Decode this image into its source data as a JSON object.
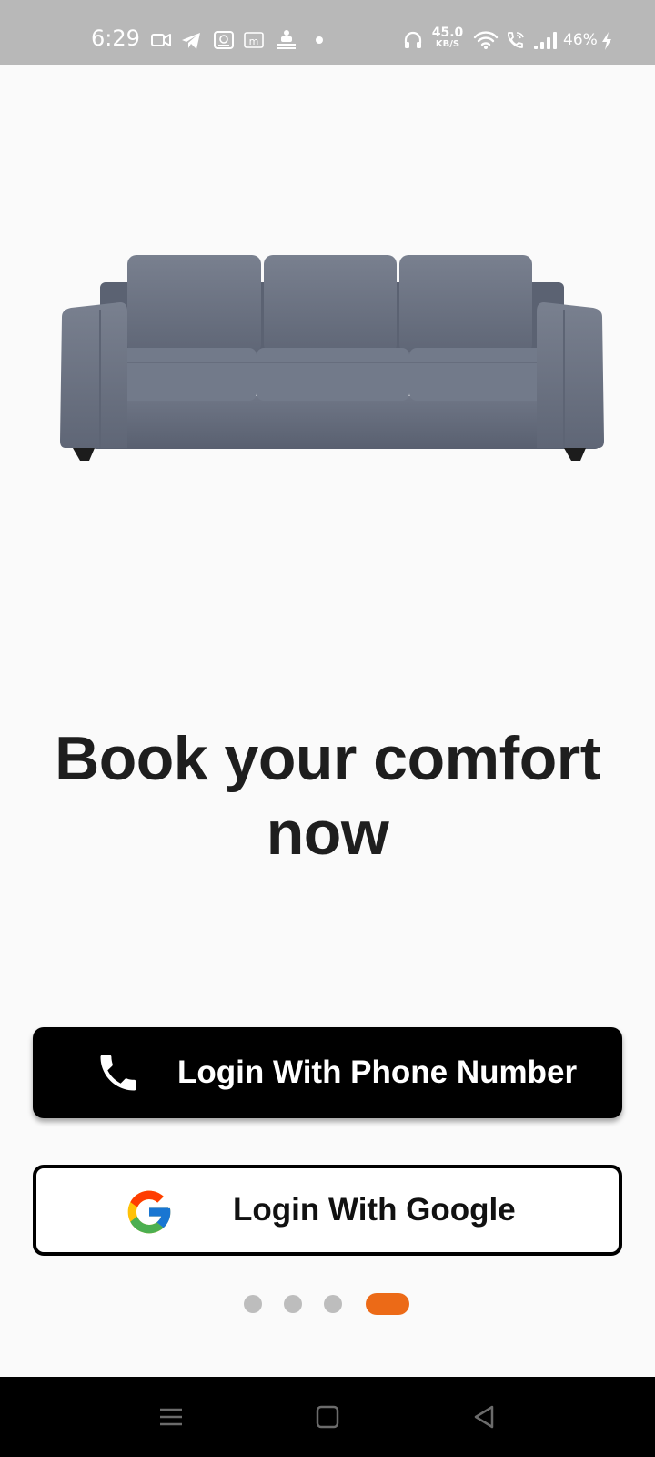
{
  "status_bar": {
    "time": "6:29",
    "network_speed_value": "45.0",
    "network_speed_unit": "KB/S",
    "battery_percent": "46%",
    "icons": [
      "video-camera-icon",
      "telegram-icon",
      "screen-record-icon",
      "m-badge-icon",
      "notification-icon",
      "dot-icon",
      "headphones-icon",
      "wifi-icon",
      "wifi-call-icon",
      "signal-bars-icon",
      "battery-charging-icon"
    ]
  },
  "hero": {
    "image": "sofa-image",
    "colors": {
      "fabric": "#6e7585",
      "fabric_dark": "#5b6272",
      "legs": "#1c1c1c"
    }
  },
  "headline": {
    "line1": "Book your comfort",
    "line2": "now"
  },
  "buttons": {
    "phone_label": "Login With Phone Number",
    "phone_icon": "phone-icon",
    "google_label": "Login With Google",
    "google_icon": "google-logo-icon"
  },
  "pager": {
    "total": 4,
    "active_index": 3,
    "active_color": "#ec6a17",
    "inactive_color": "#bdbdbd"
  },
  "nav_bar": {
    "icons": [
      "menu-icon",
      "home-square-icon",
      "back-triangle-icon"
    ]
  }
}
